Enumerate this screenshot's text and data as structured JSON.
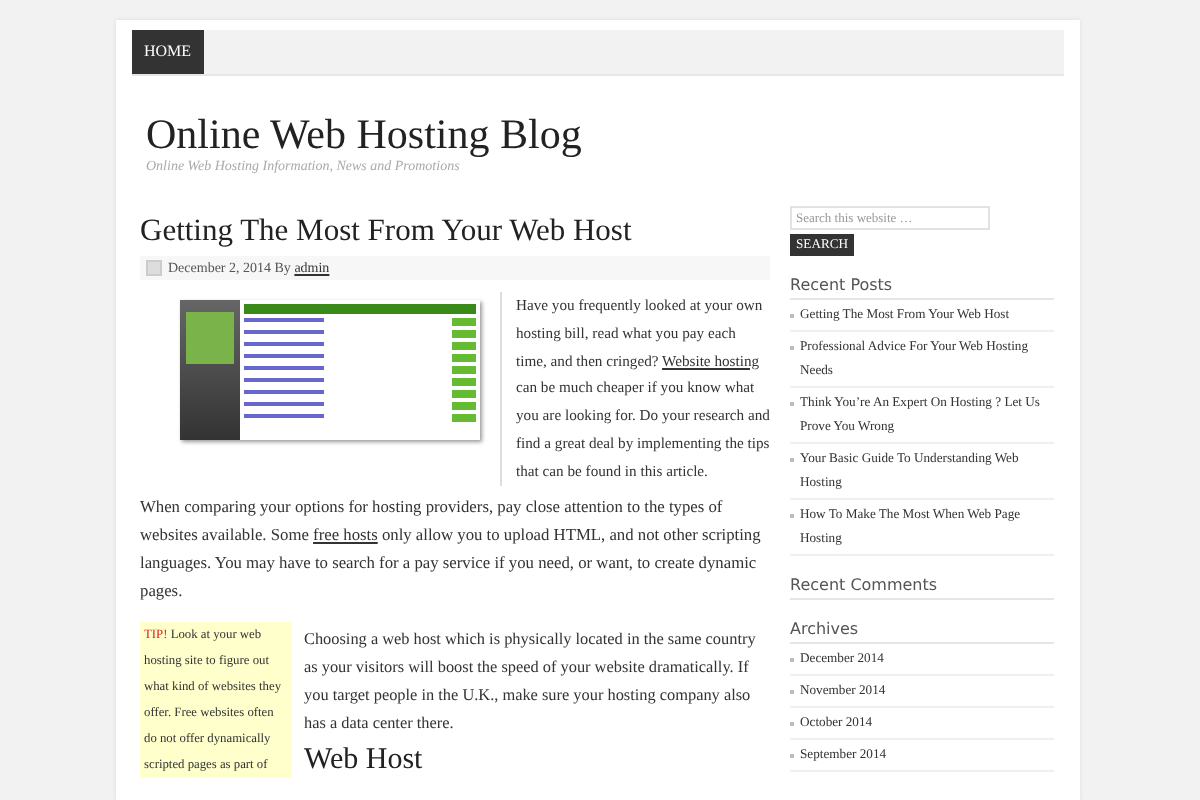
{
  "nav": {
    "items": [
      {
        "label": "HOME",
        "selected": true
      }
    ]
  },
  "site": {
    "title": "Online Web Hosting Blog",
    "tagline": "Online Web Hosting Information, News and Promotions"
  },
  "post": {
    "title": "Getting The Most From Your Web Host",
    "date": "December 2, 2014 By ",
    "author": "admin",
    "intro": [
      {
        "kind": "text",
        "text": "Have you frequently looked at your own hosting bill, read what you pay each time, and then cringed? "
      },
      {
        "kind": "link",
        "text": "Website hosting"
      },
      {
        "kind": "text",
        "text": " can be much cheaper if you know what you are looking for. Do your research and find a great deal by implementing the tips that can be found in this article."
      }
    ],
    "paragraph": [
      {
        "kind": "text",
        "text": "When comparing your options for hosting providers, pay close attention to the types of websites available. Some "
      },
      {
        "kind": "link",
        "text": "free hosts"
      },
      {
        "kind": "text",
        "text": " only allow you to upload HTML, and not other scripting languages. You may have to search for a pay service if you need, or want, to create dynamic pages."
      }
    ],
    "tip": {
      "label": "TIP!",
      "text": "Look at your web hosting site to figure out what kind of websites they offer. Free websites often do not offer dynamically scripted pages as part of"
    },
    "paragraph2": "Choosing a web host which is physically located in the same country as your visitors will boost the speed of your website dramatically. If you target people in the U.K., make sure your hosting company also has a data center there.",
    "subheading": "Web Host"
  },
  "sidebar": {
    "search": {
      "placeholder": "Search this website …",
      "button": "SEARCH"
    },
    "recent_posts": {
      "title": "Recent Posts",
      "items": [
        "Getting The Most From Your Web Host",
        "Professional Advice For Your Web Hosting Needs",
        "Think You’re An Expert On Hosting ? Let Us Prove You Wrong",
        "Your Basic Guide To Understanding Web Hosting",
        "How To Make The Most When Web Page Hosting"
      ]
    },
    "recent_comments": {
      "title": "Recent Comments"
    },
    "archives": {
      "title": "Archives",
      "items": [
        "December 2014",
        "November 2014",
        "October 2014",
        "September 2014"
      ]
    }
  }
}
